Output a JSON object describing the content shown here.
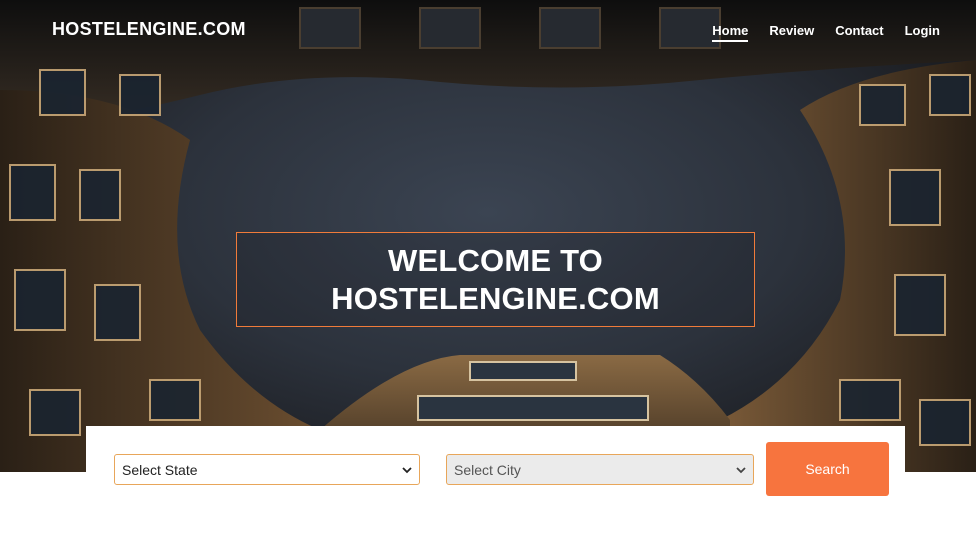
{
  "brand": "HOSTELENGINE.COM",
  "nav": {
    "items": [
      "Home",
      "Review",
      "Contact",
      "Login"
    ],
    "active": "Home"
  },
  "hero": {
    "line1": "WELCOME TO",
    "line2": "HOSTELENGINE.COM"
  },
  "search": {
    "state_label": "Select State",
    "city_label": "Select City",
    "button_label": "Search"
  },
  "colors": {
    "accent": "#f7743e",
    "box_border": "#f07b3a",
    "select_border": "#e8a65a"
  },
  "icons": {
    "select_arrow": "chevron-down-icon"
  }
}
